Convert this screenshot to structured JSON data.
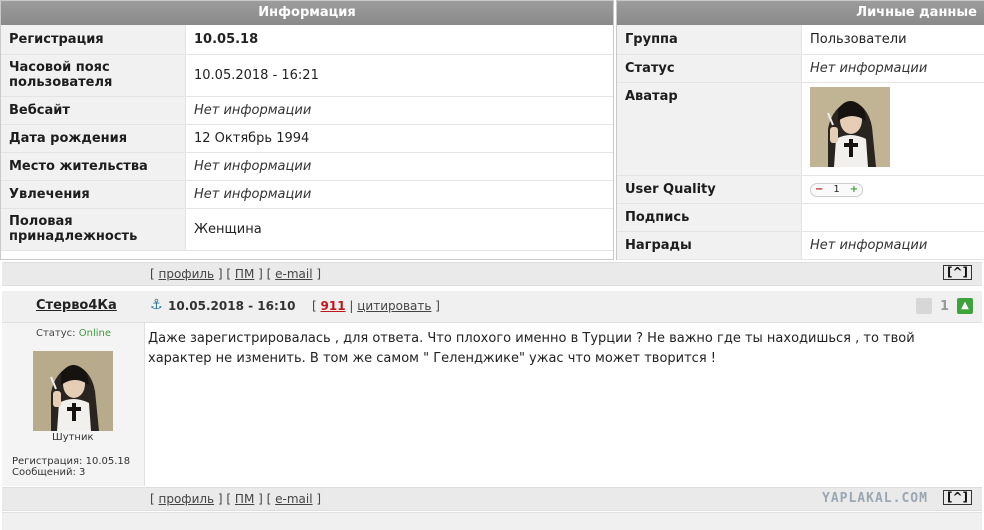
{
  "info_panel": {
    "title": "Информация",
    "rows": [
      {
        "label": "Регистрация",
        "value": "10.05.18"
      },
      {
        "label": "Часовой пояс пользователя",
        "value": "10.05.2018 - 16:21"
      },
      {
        "label": "Вебсайт",
        "value": "Нет информации"
      },
      {
        "label": "Дата рождения",
        "value": "12 Октябрь 1994"
      },
      {
        "label": "Место жительства",
        "value": "Нет информации"
      },
      {
        "label": "Увлечения",
        "value": "Нет информации"
      },
      {
        "label": "Половая принадлежность",
        "value": "Женщина"
      }
    ]
  },
  "personal_panel": {
    "title": "Личные данные",
    "rows": [
      {
        "label": "Группа",
        "value": "Пользователи"
      },
      {
        "label": "Статус",
        "value": "Нет информации"
      },
      {
        "label": "Аватар",
        "value": ""
      },
      {
        "label": "User Quality",
        "value": "1"
      },
      {
        "label": "Подпись",
        "value": ""
      },
      {
        "label": "Награды",
        "value": "Нет информации"
      }
    ],
    "quality_minus": "−",
    "quality_plus": "+"
  },
  "links": {
    "profile": "профиль",
    "pm": "ПМ",
    "email": "e-mail",
    "top": "^"
  },
  "post": {
    "author": "Стерво4Ка",
    "anchor_icon": "⚓",
    "date": "10.05.2018 - 16:10",
    "number": "911",
    "quote": "цитировать",
    "votes": "1",
    "status_label": "Статус:",
    "status_value": "Online",
    "rank": "Шутник",
    "reg_line": "Регистрация: 10.05.18",
    "posts_line": "Сообщений: 3",
    "text": "Даже зарегистрировалась , для ответа. Что плохого именно в Турции ? Не важно где ты находишься , то твой характер не изменить. В том же самом \" Геленджике\" ужас что может творится !"
  },
  "watermark": "YAPLAKAL.COM",
  "colors": {
    "header": "#939393",
    "label_bg": "#f1f1f1",
    "accent_red": "#c0161b",
    "online": "#3b9d3b",
    "vote_up": "#3da33a"
  }
}
